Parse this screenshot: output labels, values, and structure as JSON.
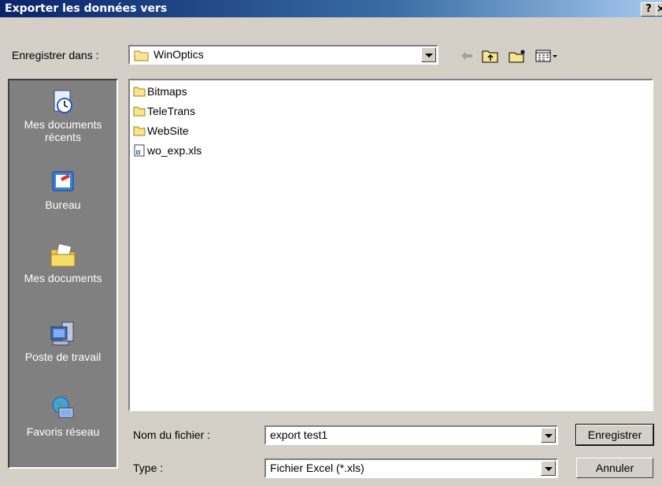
{
  "window": {
    "title": "Exporter les données vers",
    "help_label": "?",
    "close_label": "×"
  },
  "save_in": {
    "label": "Enregistrer dans :",
    "value": "WinOptics"
  },
  "toolbar": {
    "back_icon": "back-arrow-icon",
    "up_icon": "up-folder-icon",
    "new_folder_icon": "new-folder-icon",
    "views_icon": "view-menu-icon"
  },
  "places": [
    {
      "label": "Mes documents récents",
      "icon": "recent-documents-icon"
    },
    {
      "label": "Bureau",
      "icon": "desktop-icon"
    },
    {
      "label": "Mes documents",
      "icon": "my-documents-icon"
    },
    {
      "label": "Poste de travail",
      "icon": "my-computer-icon"
    },
    {
      "label": "Favoris réseau",
      "icon": "network-places-icon"
    }
  ],
  "files": [
    {
      "name": "Bitmaps",
      "type": "folder"
    },
    {
      "name": "TeleTrans",
      "type": "folder"
    },
    {
      "name": "WebSite",
      "type": "folder"
    },
    {
      "name": "wo_exp.xls",
      "type": "file"
    }
  ],
  "filename": {
    "label": "Nom du fichier :",
    "value": "export test1"
  },
  "filetype": {
    "label": "Type :",
    "value": "Fichier Excel (*.xls)"
  },
  "buttons": {
    "save": "Enregistrer",
    "cancel": "Annuler"
  }
}
